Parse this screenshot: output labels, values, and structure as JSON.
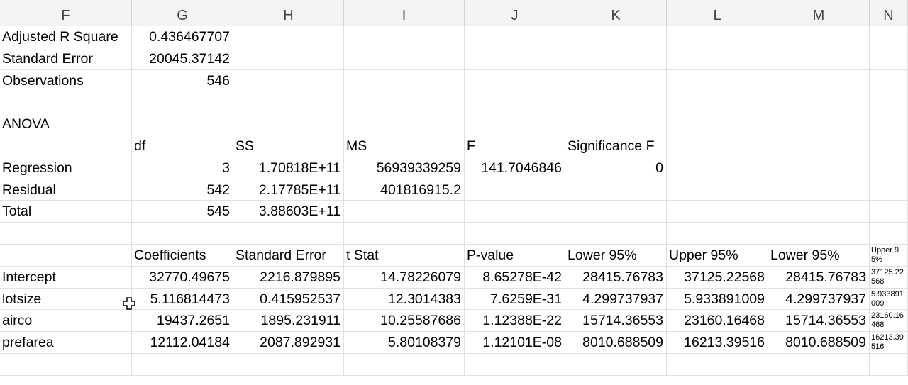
{
  "columns": [
    "F",
    "G",
    "H",
    "I",
    "J",
    "K",
    "L",
    "M",
    "N"
  ],
  "rows": [
    [
      "Adjusted R Square",
      "0.436467707"
    ],
    [
      "Standard Error",
      "20045.37142"
    ],
    [
      "Observations",
      "546"
    ],
    [],
    [
      "ANOVA"
    ],
    [
      "",
      "df",
      "SS",
      "MS",
      "F",
      "Significance F"
    ],
    [
      "Regression",
      "3",
      "1.70818E+11",
      "56939339259",
      "141.7046846",
      "0"
    ],
    [
      "Residual",
      "542",
      "2.17785E+11",
      "401816915.2"
    ],
    [
      "Total",
      "545",
      "3.88603E+11"
    ],
    [],
    [
      "",
      "Coefficients",
      "Standard Error",
      "t Stat",
      "P-value",
      "Lower 95%",
      "Upper 95%",
      "Lower 95%",
      "Upper 95%"
    ],
    [
      "Intercept",
      "32770.49675",
      "2216.879895",
      "14.78226079",
      "8.65278E-42",
      "28415.76783",
      "37125.22568",
      "28415.76783",
      "37125.22568"
    ],
    [
      "lotsize",
      "5.116814473",
      "0.415952537",
      "12.3014383",
      "7.6259E-31",
      "4.299737937",
      "5.933891009",
      "4.299737937",
      "5.933891009"
    ],
    [
      "airco",
      "19437.2651",
      "1895.231911",
      "10.25587686",
      "1.12388E-22",
      "15714.36553",
      "23160.16468",
      "15714.36553",
      "23160.16468"
    ],
    [
      "prefarea",
      "12112.04184",
      "2087.892931",
      "5.80108379",
      "1.12101E-08",
      "8010.688509",
      "16213.39516",
      "8010.688509",
      "16213.39516"
    ],
    []
  ],
  "cursor_icon": "cell-select-cross-cursor"
}
